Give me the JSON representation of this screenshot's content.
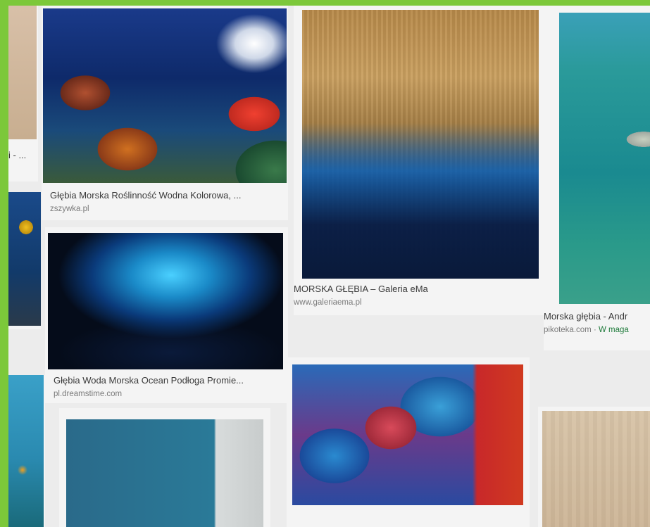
{
  "results": [
    {
      "id": "left-col-1-caption",
      "title": "i - ..."
    },
    {
      "id": "reef",
      "title": "Głębia Morska Roślinność Wodna Kolorowa, ...",
      "source": "zszywka.pl"
    },
    {
      "id": "abstract",
      "title": "MORSKA GŁĘBIA – Galeria eMa",
      "source": "www.galeriaema.pl"
    },
    {
      "id": "boat",
      "title": "Morska głębia - Andr",
      "source": "pikoteka.com · ",
      "shop": "W maga"
    },
    {
      "id": "deep",
      "title": "Głębia Woda Morska Ocean Podłoga Promie...",
      "source": "pl.dreamstime.com"
    }
  ],
  "colors": {
    "frame_green": "#7cc83a",
    "page_bg": "#ececec",
    "title_text": "#3a3a3a",
    "source_text": "#7a7a7a",
    "shop_green": "#1e7a3a"
  }
}
